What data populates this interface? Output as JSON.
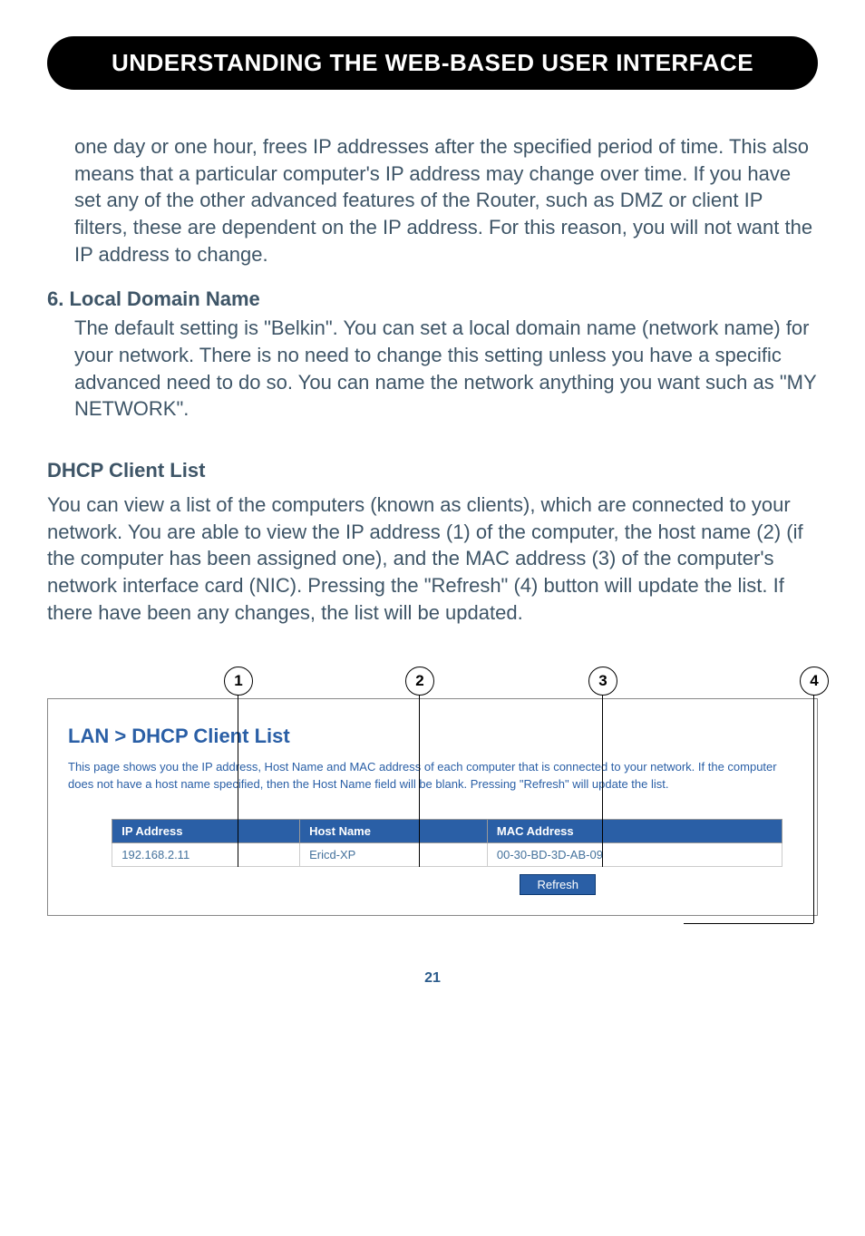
{
  "chapter_title": "UNDERSTANDING THE WEB-BASED USER INTERFACE",
  "para_continuation": "one day or one hour, frees IP addresses after the specified period of time. This also means that a particular computer's IP address may change over time. If you have set any of the other advanced features of the Router, such as DMZ or client IP filters, these are dependent on the IP address. For this reason, you will not want the IP address to change.",
  "item6_num": "6.",
  "item6_title": "Local Domain Name",
  "item6_body": "The default setting is \"Belkin\". You can set a local domain name (network name) for your network. There is no need to change this setting unless you have a specific advanced need to do so. You can name the network anything you want such as \"MY NETWORK\".",
  "dhcp_heading": "DHCP Client List",
  "dhcp_para": "You can view a list of the computers (known as clients), which are connected to your network. You are able to view the IP address (1) of the computer, the host name (2) (if the computer has been assigned one), and the MAC address (3) of the computer's network interface card (NIC). Pressing the \"Refresh\" (4) button will update the list. If there have been any changes, the list will be updated.",
  "callouts": {
    "c1": "1",
    "c2": "2",
    "c3": "3",
    "c4": "4"
  },
  "screenshot": {
    "title": "LAN > DHCP Client List",
    "description": "This page shows you the IP address, Host Name and MAC address of each computer that is connected to your network. If the computer does not have a host name specified, then the Host Name field will be blank. Pressing \"Refresh\" will update the list.",
    "headers": {
      "ip": "IP Address",
      "host": "Host Name",
      "mac": "MAC Address"
    },
    "row": {
      "ip": "192.168.2.11",
      "host": "Ericd-XP",
      "mac": "00-30-BD-3D-AB-09"
    },
    "refresh": "Refresh"
  },
  "page_number": "21"
}
